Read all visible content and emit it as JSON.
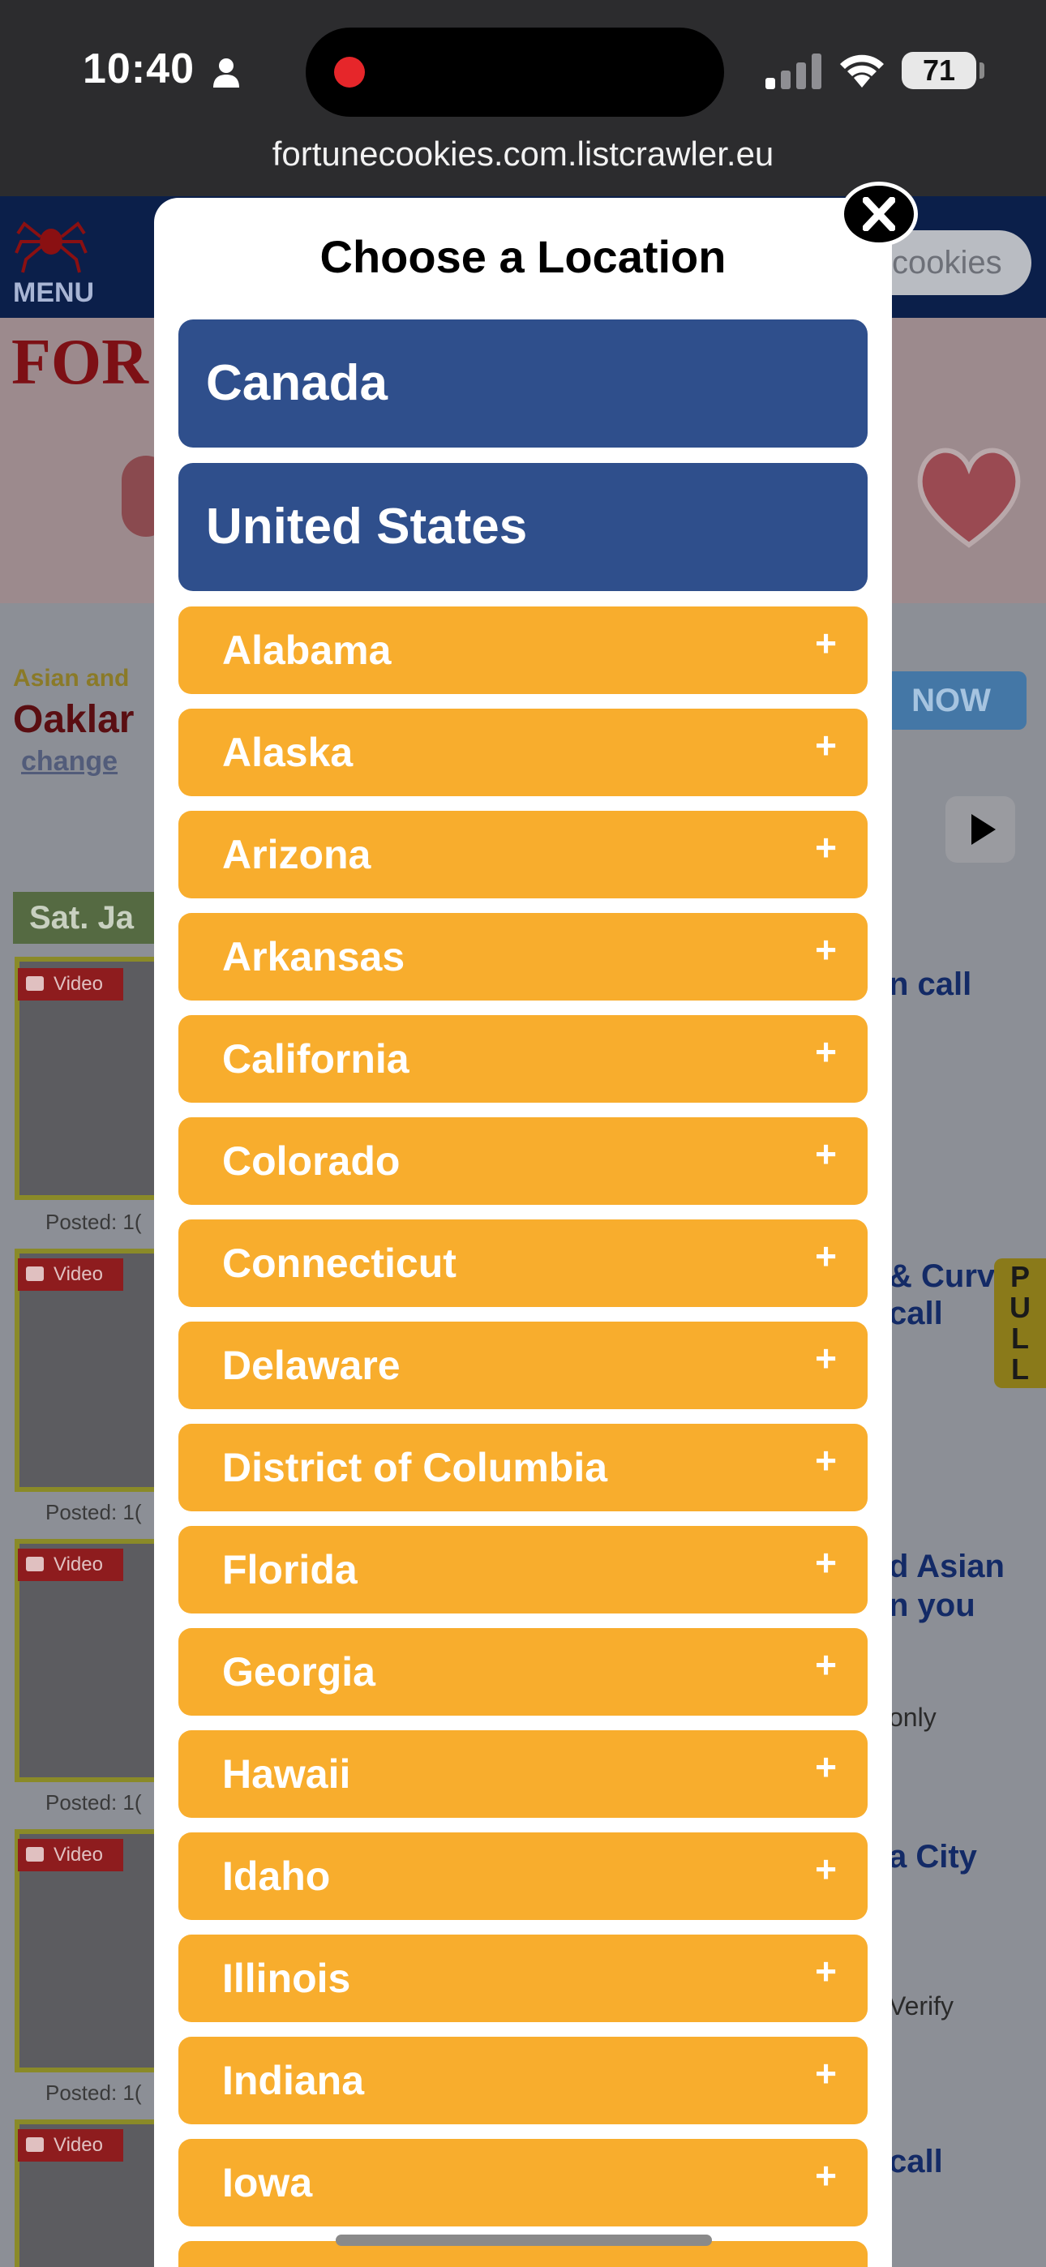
{
  "status_bar": {
    "time": "10:40",
    "battery": "71"
  },
  "browser": {
    "url": "fortunecookies.com.listcrawler.eu"
  },
  "background_page": {
    "menu_label": "MENU",
    "search_text": "cookies",
    "banner_text": "FOR",
    "small_heading": "Asian and",
    "city": "Oaklar",
    "change_link": "change",
    "now_button": "NOW",
    "date_heading": "Sat. Ja",
    "video_tag": "Video",
    "posted": "Posted: 1(",
    "pull_tab": "PULL",
    "right_snippets": [
      "n call",
      "& Curv",
      "call",
      "d Asian",
      "n you",
      "only",
      "a City",
      "Verify",
      "call"
    ]
  },
  "modal": {
    "title": "Choose a Location",
    "countries": [
      "Canada",
      "United States"
    ],
    "states": [
      "Alabama",
      "Alaska",
      "Arizona",
      "Arkansas",
      "California",
      "Colorado",
      "Connecticut",
      "Delaware",
      "District of Columbia",
      "Florida",
      "Georgia",
      "Hawaii",
      "Idaho",
      "Illinois",
      "Indiana",
      "Iowa"
    ],
    "expand_symbol": "+"
  },
  "colors": {
    "country_button": "#2f4f8c",
    "state_button": "#f8ad2d",
    "close_button": "#000000"
  }
}
